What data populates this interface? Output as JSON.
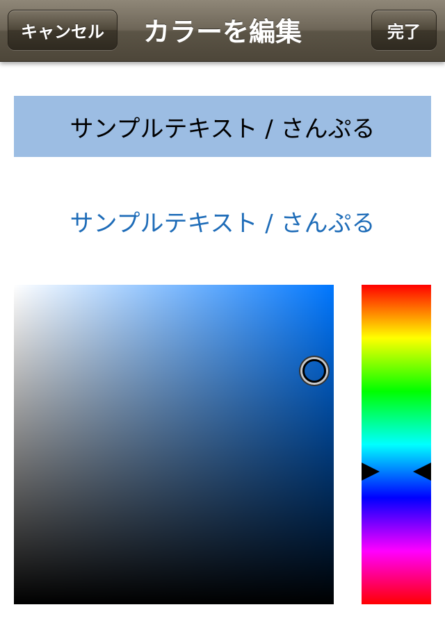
{
  "nav": {
    "cancel_label": "キャンセル",
    "title": "カラーを編集",
    "done_label": "完了"
  },
  "preview": {
    "background_sample_text": "サンプルテキスト / さんぷる",
    "background_sample_color": "#9cbde3",
    "foreground_sample_text": "サンプルテキスト / さんぷる",
    "foreground_sample_color": "#1e6cb8"
  },
  "picker": {
    "hue_color": "#0077ff",
    "saturation": 0.94,
    "brightness": 0.73,
    "hue_fraction": 0.585
  },
  "colors": {
    "navbar": "#6e6658",
    "page_background": "#ffffff"
  }
}
